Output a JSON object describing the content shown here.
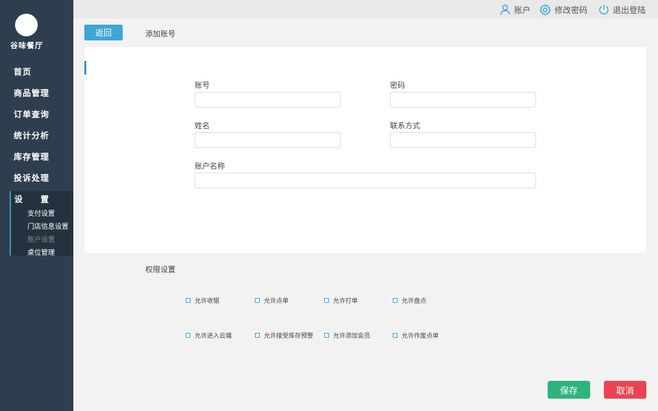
{
  "sidebar": {
    "brand": "谷味餐厅",
    "items": [
      {
        "label": "首页"
      },
      {
        "label": "商品管理"
      },
      {
        "label": "订单查询"
      },
      {
        "label": "统计分析"
      },
      {
        "label": "库存管理"
      },
      {
        "label": "投诉处理"
      }
    ],
    "settings": {
      "title": "设 置",
      "sub_items": [
        {
          "label": "支付设置"
        },
        {
          "label": "门店信息设置"
        },
        {
          "label": "账户设置"
        },
        {
          "label": "桌位管理"
        }
      ],
      "active_sub": "账户设置"
    }
  },
  "topbar": {
    "account": "账户",
    "change_password": "修改密码",
    "logout": "退出登陆"
  },
  "header": {
    "back": "返回",
    "breadcrumb": "添加账号"
  },
  "form": {
    "account": {
      "label": "账号",
      "value": ""
    },
    "password": {
      "label": "密码",
      "value": ""
    },
    "name": {
      "label": "姓名",
      "value": ""
    },
    "contact": {
      "label": "联系方式",
      "value": ""
    },
    "account_name": {
      "label": "账户名称",
      "value": ""
    }
  },
  "permissions": {
    "title": "权限设置",
    "items": [
      {
        "label": "允许收银",
        "checked": false
      },
      {
        "label": "允许点单",
        "checked": false
      },
      {
        "label": "允许打单",
        "checked": false
      },
      {
        "label": "允许盘点",
        "checked": false
      },
      {
        "label": "允许进入云端",
        "checked": false
      },
      {
        "label": "允许接受库存预警",
        "checked": false
      },
      {
        "label": "允许添加会员",
        "checked": false
      },
      {
        "label": "允许作废点单",
        "checked": false
      }
    ]
  },
  "actions": {
    "save": "保存",
    "cancel": "取消"
  },
  "colors": {
    "sidebar_bg": "#2e3e4e",
    "accent_blue": "#3fa6d4",
    "save_green": "#2eb37c",
    "cancel_red": "#ea4452"
  },
  "icons": {
    "account": "user-icon",
    "change_password": "gear-icon",
    "logout": "power-icon"
  }
}
